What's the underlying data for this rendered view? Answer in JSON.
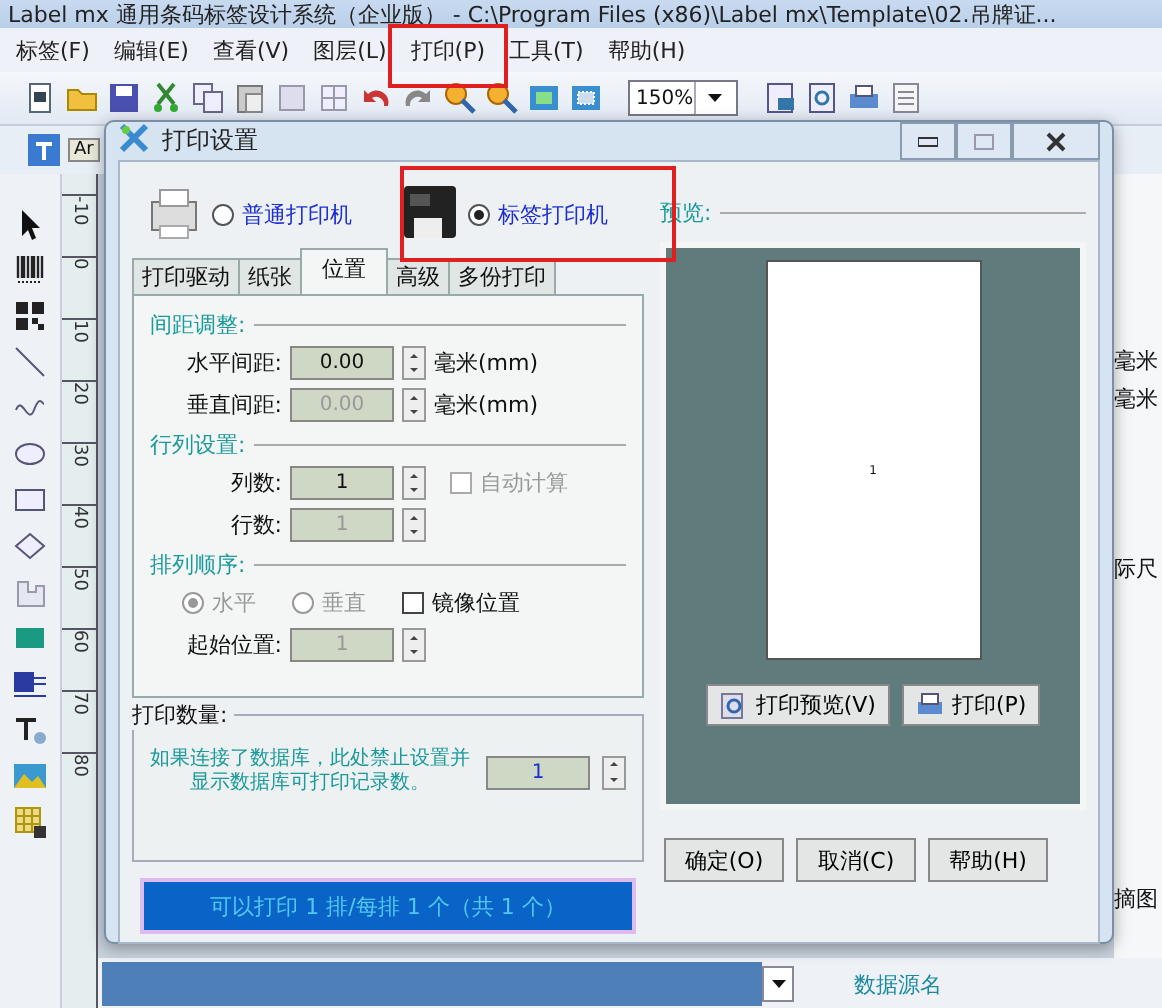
{
  "app": {
    "title": "Label mx 通用条码标签设计系统（企业版） - C:\\Program Files (x86)\\Label mx\\Template\\02.吊牌证...",
    "menu": [
      "标签(F)",
      "编辑(E)",
      "查看(V)",
      "图层(L)",
      "打印(P)",
      "工具(T)",
      "帮助(H)"
    ],
    "zoom": "150%",
    "font_box": "Ar",
    "ruler": [
      "-10",
      "0",
      "10",
      "20",
      "30",
      "40",
      "50",
      "60",
      "70",
      "80"
    ],
    "side_texts": [
      "毫米",
      "毫米",
      "际尺",
      "摘图"
    ],
    "data_source_label": "数据源名"
  },
  "dialog": {
    "title": "打印设置",
    "printer_types": [
      {
        "label": "普通打印机",
        "selected": false
      },
      {
        "label": "标签打印机",
        "selected": true
      }
    ],
    "tabs": [
      {
        "label": "打印驱动",
        "selected": false
      },
      {
        "label": "纸张",
        "selected": false
      },
      {
        "label": "位置",
        "selected": true
      },
      {
        "label": "高级",
        "selected": false
      },
      {
        "label": "多份打印",
        "selected": false
      }
    ],
    "spacing": {
      "heading": "间距调整:",
      "fields": [
        {
          "label": "水平间距:",
          "value": "0.00",
          "unit": "毫米(mm)",
          "disabled": false
        },
        {
          "label": "垂直间距:",
          "value": "0.00",
          "unit": "毫米(mm)",
          "disabled": true
        }
      ]
    },
    "grid": {
      "heading": "行列设置:",
      "fields": [
        {
          "label": "列数:",
          "value": "1",
          "disabled": false
        },
        {
          "label": "行数:",
          "value": "1",
          "disabled": true
        }
      ],
      "auto": {
        "label": "自动计算",
        "checked": false,
        "disabled": true
      }
    },
    "order": {
      "heading": "排列顺序:",
      "options": [
        {
          "label": "水平",
          "selected": true,
          "disabled": true
        },
        {
          "label": "垂直",
          "selected": false,
          "disabled": true
        }
      ],
      "mirror": {
        "label": "镜像位置",
        "checked": false,
        "disabled": false
      },
      "start": {
        "label": "起始位置:",
        "value": "1",
        "disabled": true
      }
    },
    "quantity": {
      "heading": "打印数量:",
      "note": "如果连接了数据库，此处禁止设置并显示数据库可打印记录数。",
      "value": "1"
    },
    "status": "可以打印 1 排/每排 1 个（共 1 个）",
    "preview": {
      "heading": "预览:",
      "page_number": "1",
      "buttons": [
        "打印预览(V)",
        "打印(P)"
      ]
    },
    "buttons": [
      "确定(O)",
      "取消(C)",
      "帮助(H)"
    ]
  }
}
